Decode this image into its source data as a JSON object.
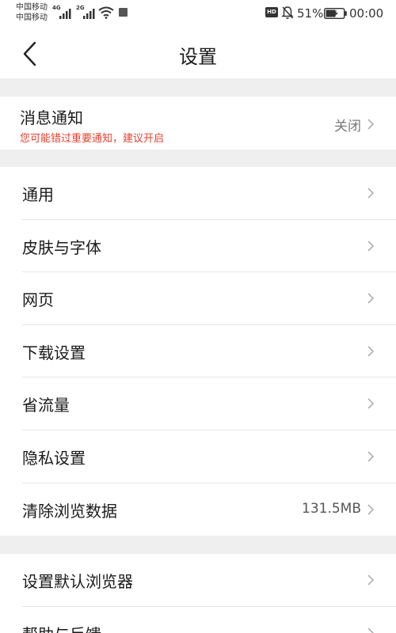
{
  "status_bar": {
    "carrier1": "中国移动",
    "carrier2": "中国移动",
    "sim1_network": "4G",
    "sim2_network": "2G",
    "hd_badge": "HD",
    "battery_percent": "51%",
    "time": "00:00",
    "icons": [
      "signal-icon",
      "wifi-icon",
      "hd-icon",
      "mute-bell-icon",
      "battery-charging-icon"
    ]
  },
  "header": {
    "title": "设置",
    "back_icon": "chevron-left-icon"
  },
  "notification": {
    "title": "消息通知",
    "subtitle": "您可能错过重要通知，建议开启",
    "value": "关闭",
    "subtitle_color": "#e5402f"
  },
  "group1": [
    {
      "label": "通用"
    },
    {
      "label": "皮肤与字体"
    },
    {
      "label": "网页"
    },
    {
      "label": "下载设置"
    },
    {
      "label": "省流量"
    },
    {
      "label": "隐私设置"
    },
    {
      "label": "清除浏览数据",
      "value": "131.5MB"
    }
  ],
  "group2": [
    {
      "label": "设置默认浏览器"
    },
    {
      "label": "帮助与反馈"
    }
  ],
  "colors": {
    "background": "#ffffff",
    "section_gap": "#efefef",
    "warning": "#e5402f",
    "chevron": "#b0b0b0"
  }
}
